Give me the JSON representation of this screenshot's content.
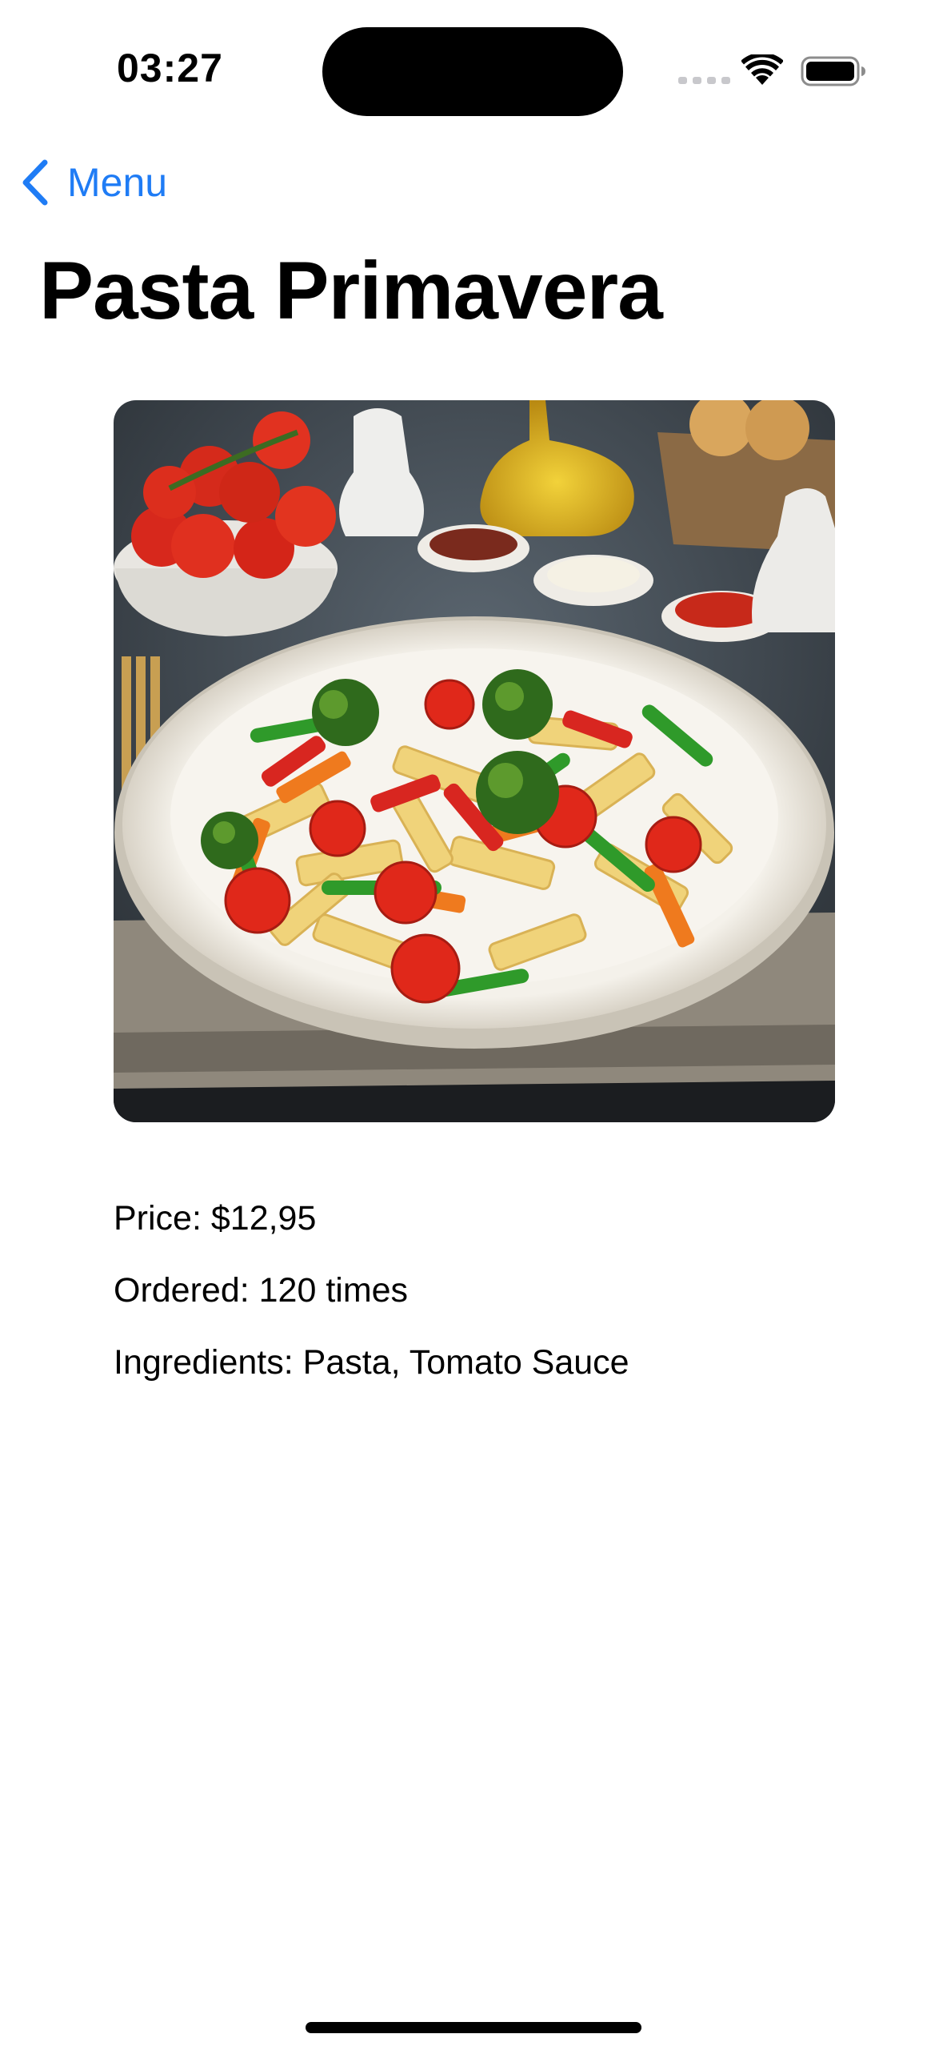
{
  "status_bar": {
    "time": "03:27",
    "signal_icon": "cellular-signal-icon",
    "wifi_icon": "wifi-icon",
    "battery_icon": "battery-icon"
  },
  "nav": {
    "back_label": "Menu",
    "back_icon": "chevron-left-icon",
    "accent_color": "#1f7cf5"
  },
  "dish": {
    "title": "Pasta Primavera",
    "image": "pasta-primavera-photo",
    "price_line": "Price: $12,95",
    "ordered_line": "Ordered: 120 times",
    "ingredients_line": "Ingredients: Pasta, Tomato Sauce"
  }
}
